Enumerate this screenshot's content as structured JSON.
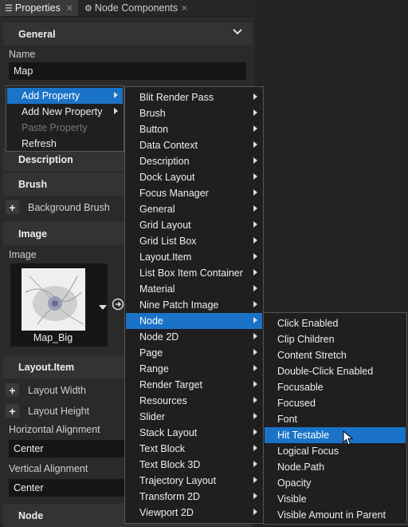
{
  "tabs": [
    {
      "label": "Properties",
      "icon": "properties-icon"
    },
    {
      "label": "Node Components",
      "icon": "node-components-icon"
    }
  ],
  "panel": {
    "general_title": "General",
    "name_label": "Name",
    "name_value": "Map",
    "description_title": "Description",
    "brush_title": "Brush",
    "background_brush_label": "Background Brush",
    "image_title": "Image",
    "image_label": "Image",
    "image_name": "Map_Big",
    "layout_item_title": "Layout.Item",
    "layout_width_label": "Layout Width",
    "layout_height_label": "Layout Height",
    "horizontal_alignment_label": "Horizontal Alignment",
    "horizontal_alignment_value": "Center",
    "vertical_alignment_label": "Vertical Alignment",
    "vertical_alignment_value": "Center",
    "node_title": "Node"
  },
  "context_menu": {
    "items": [
      {
        "label": "Add Property",
        "submenu": true,
        "selected": true,
        "disabled": false
      },
      {
        "label": "Add New Property",
        "submenu": true,
        "selected": false,
        "disabled": false
      },
      {
        "label": "Paste Property",
        "submenu": false,
        "selected": false,
        "disabled": true
      },
      {
        "label": "Refresh",
        "submenu": false,
        "selected": false,
        "disabled": false
      }
    ]
  },
  "add_property_menu": {
    "items": [
      "Blit Render Pass",
      "Brush",
      "Button",
      "Data Context",
      "Description",
      "Dock Layout",
      "Focus Manager",
      "General",
      "Grid Layout",
      "Grid List Box",
      "Layout.Item",
      "List Box Item Container",
      "Material",
      "Nine Patch Image",
      "Node",
      "Node 2D",
      "Page",
      "Range",
      "Render Target",
      "Resources",
      "Slider",
      "Stack Layout",
      "Text Block",
      "Text Block 3D",
      "Trajectory Layout",
      "Transform 2D",
      "Viewport 2D"
    ],
    "selected": "Node"
  },
  "node_menu": {
    "items": [
      "Click Enabled",
      "Clip Children",
      "Content Stretch",
      "Double-Click Enabled",
      "Focusable",
      "Focused",
      "Font",
      "Hit Testable",
      "Logical Focus",
      "Node.Path",
      "Opacity",
      "Visible",
      "Visible Amount in Parent"
    ],
    "selected": "Hit Testable"
  },
  "colors": {
    "accent": "#1a73c7",
    "background": "#2a2a2a",
    "menu_background": "#1f1f1f"
  }
}
